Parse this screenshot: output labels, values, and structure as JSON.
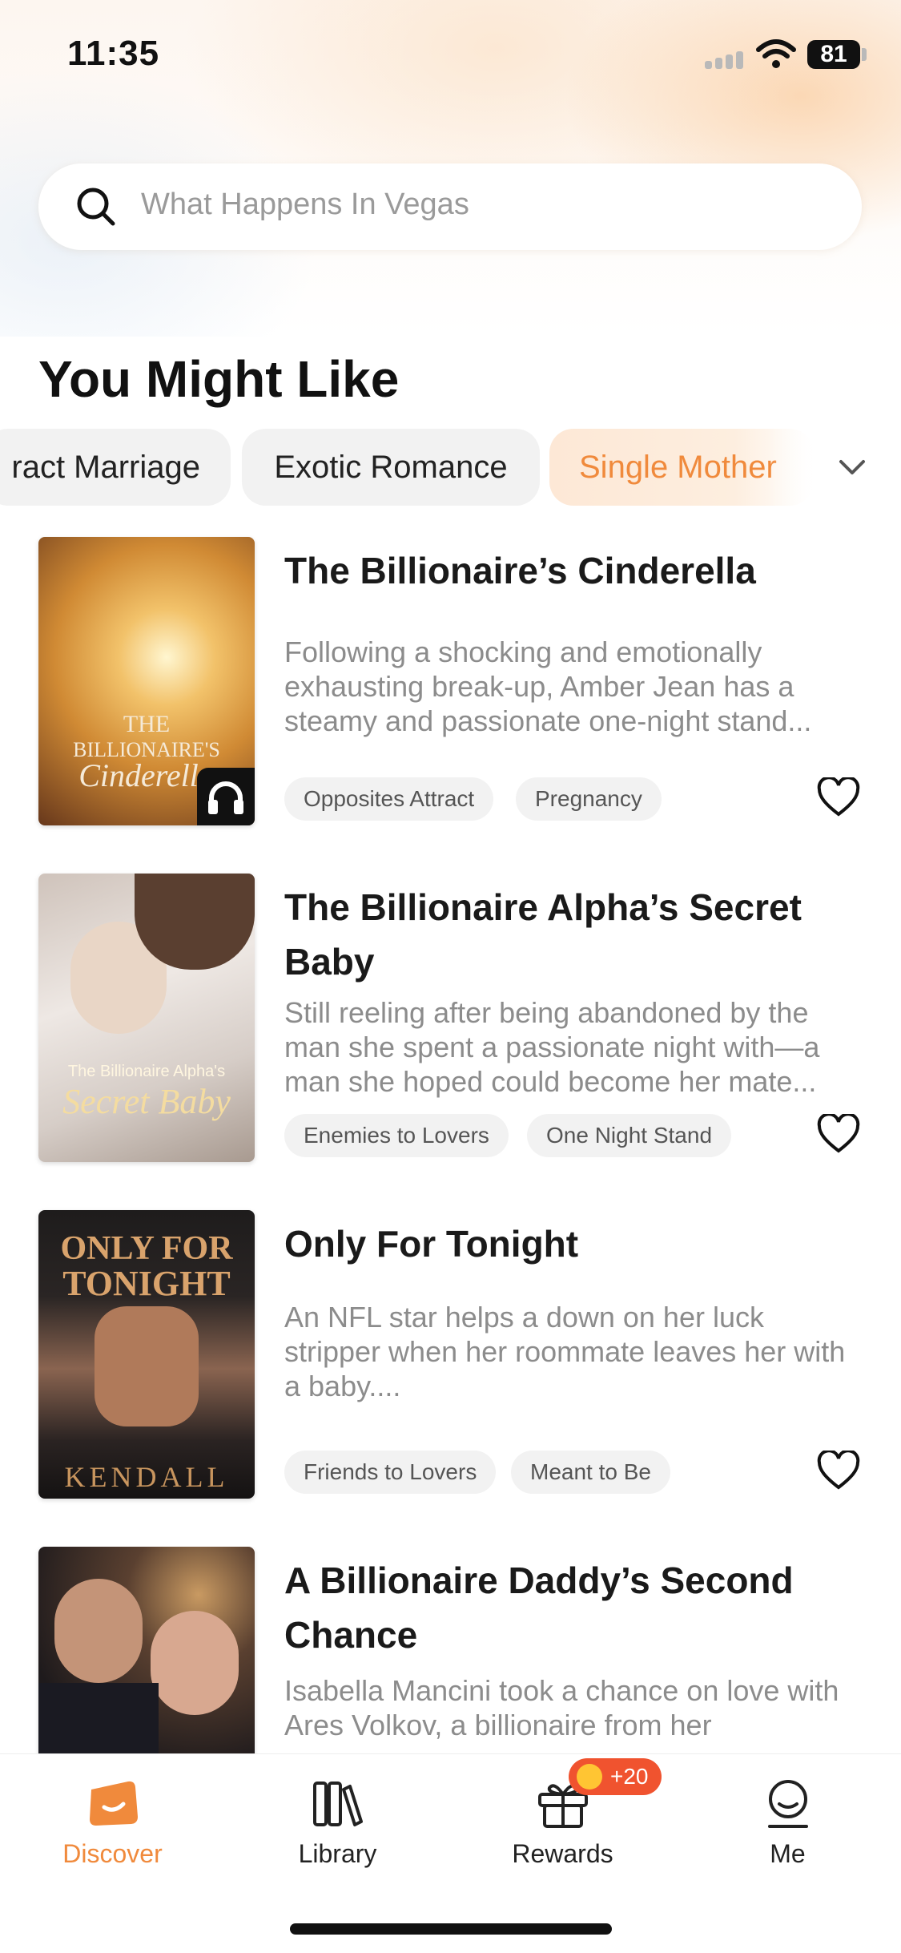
{
  "status": {
    "time": "11:35",
    "battery": "81"
  },
  "search": {
    "placeholder": "What Happens In Vegas"
  },
  "section": {
    "title": "You Might Like"
  },
  "chips": [
    "ract Marriage",
    "Exotic Romance",
    "Single Mother"
  ],
  "books": [
    {
      "title": "The Billionaire’s Cinderella",
      "description": "Following a shocking and emotionally exhausting break-up, Amber Jean has a steamy and passionate one-night stand...",
      "tags": [
        "Opposites Attract",
        "Pregnancy"
      ],
      "cover_text": [
        "THE",
        "BILLIONAIRE'S",
        "Cinderella"
      ]
    },
    {
      "title": "The Billionaire Alpha’s Secret Baby",
      "description": "Still reeling after being abandoned by the man she spent a passionate night with—a man she hoped could become her mate...",
      "tags": [
        "Enemies to Lovers",
        "One Night Stand"
      ],
      "cover_text": [
        "The Billionaire Alpha's",
        "Secret Baby"
      ]
    },
    {
      "title": "Only For Tonight",
      "description": "An NFL star helps a down on her luck stripper when her roommate leaves her with a baby....",
      "tags": [
        "Friends to Lovers",
        "Meant to Be"
      ],
      "cover_text": [
        "ONLY FOR",
        "TONIGHT",
        "KENDALL"
      ]
    },
    {
      "title": "A Billionaire Daddy’s Second Chance",
      "description": "Isabella Mancini took a chance on love with Ares Volkov, a billionaire from her",
      "tags": [],
      "cover_text": []
    }
  ],
  "tabs": [
    {
      "label": "Discover",
      "icon": "discover-icon"
    },
    {
      "label": "Library",
      "icon": "library-icon"
    },
    {
      "label": "Rewards",
      "icon": "gift-icon"
    },
    {
      "label": "Me",
      "icon": "profile-icon"
    }
  ],
  "rewards_badge": "+20",
  "colors": {
    "accent": "#f08a3c",
    "badge": "#f0532f"
  }
}
